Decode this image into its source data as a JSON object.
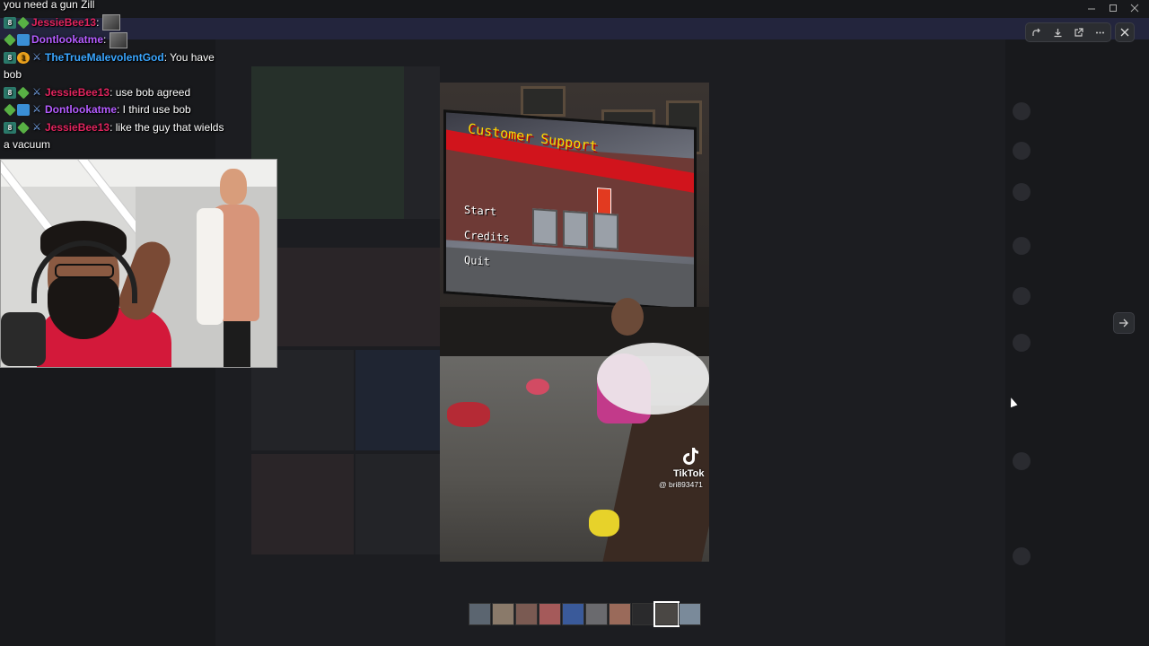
{
  "chat": {
    "lines": [
      {
        "badges": [],
        "user": "",
        "user_color": "#ffffff",
        "message": "you need a gun Zill"
      },
      {
        "badges": [
          "num",
          "star"
        ],
        "user": "JessieBee13",
        "user_color": "#e0245e",
        "message": ":",
        "emote": true
      },
      {
        "badges": [
          "star",
          "cube"
        ],
        "user": "Dontlookatme",
        "user_color": "#b45cff",
        "message": ":",
        "emote": true
      },
      {
        "badges": [
          "num",
          "gold",
          "sword"
        ],
        "user": "TheTrueMalevolentGod",
        "user_color": "#3aa6ff",
        "message": ": You have bob"
      },
      {
        "badges": [
          "num",
          "star",
          "sword"
        ],
        "user": "JessieBee13",
        "user_color": "#e0245e",
        "message": ": use bob agreed"
      },
      {
        "badges": [
          "star",
          "cube",
          "sword"
        ],
        "user": "Dontlookatme",
        "user_color": "#b45cff",
        "message": ": I third use bob"
      },
      {
        "badges": [
          "num",
          "star",
          "sword"
        ],
        "user": "JessieBee13",
        "user_color": "#e0245e",
        "message": ": like the guy that wields a vacuum"
      }
    ]
  },
  "video": {
    "game_title": "Customer Support",
    "menu": [
      "Start",
      "Credits",
      "Quit"
    ],
    "watermark_brand": "TikTok",
    "watermark_handle": "@ bri893471"
  },
  "viewer": {
    "toolbar_icons": [
      "share-icon",
      "download-icon",
      "open-external-icon",
      "more-icon"
    ],
    "close_icon": "close-icon",
    "next_icon": "arrow-right-icon",
    "thumbnail_count": 10,
    "active_thumbnail": 9
  },
  "colors": {
    "overlay": "#141416",
    "toolbar_bg": "#2b2d31",
    "banner": "#2a2b55"
  }
}
